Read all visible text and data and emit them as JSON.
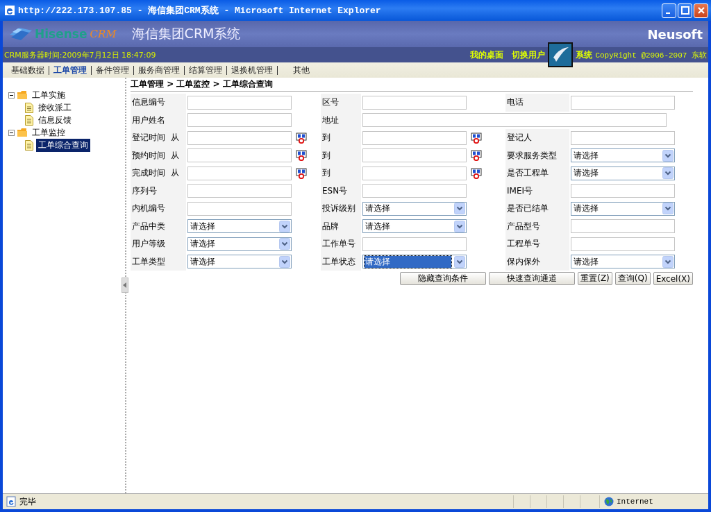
{
  "window": {
    "title": "http://222.173.107.85 - 海信集团CRM系统 - Microsoft Internet Explorer"
  },
  "header": {
    "brand": "Hisense",
    "brand_suffix": "CRM",
    "system_name": "海信集团CRM系统",
    "vendor": "Neusoft"
  },
  "info_bar": {
    "server_time": "CRM服务器时间:2009年7月12日 18:47:09",
    "links": [
      "我的桌面",
      "切换用户",
      "系统"
    ],
    "copyright": "CopyRight @2006-2007 东软"
  },
  "nav": [
    {
      "label": "基础数据",
      "selected": false
    },
    {
      "label": "工单管理",
      "selected": true
    },
    {
      "label": "备件管理",
      "selected": false
    },
    {
      "label": "服务商管理",
      "selected": false
    },
    {
      "label": "结算管理",
      "selected": false
    },
    {
      "label": "退换机管理",
      "selected": false
    },
    {
      "label": "其他",
      "selected": false
    }
  ],
  "tree": [
    {
      "label": "工单实施",
      "expanded": true,
      "children": [
        {
          "label": "接收派工",
          "selected": false
        },
        {
          "label": "信息反馈",
          "selected": false
        }
      ]
    },
    {
      "label": "工单监控",
      "expanded": true,
      "children": [
        {
          "label": "工单综合查询",
          "selected": true
        }
      ]
    }
  ],
  "breadcrumb": "工单管理 > 工单监控 > 工单综合查询",
  "form_rows": [
    {
      "fields": [
        {
          "label": "信息编号",
          "kind": "text"
        },
        {
          "label": "区号",
          "kind": "text"
        },
        {
          "label": "电话",
          "kind": "text"
        }
      ]
    },
    {
      "fields": [
        {
          "label": "用户姓名",
          "kind": "text"
        },
        {
          "label": "地址",
          "kind": "wide"
        }
      ]
    },
    {
      "fields": [
        {
          "label": "登记时间  从",
          "kind": "date"
        },
        {
          "label": "到",
          "kind": "date"
        },
        {
          "label": "登记人",
          "kind": "text"
        }
      ]
    },
    {
      "fields": [
        {
          "label": "预约时间  从",
          "kind": "date"
        },
        {
          "label": "到",
          "kind": "date"
        },
        {
          "label": "要求服务类型",
          "kind": "select",
          "value": "请选择",
          "focused": false
        }
      ]
    },
    {
      "fields": [
        {
          "label": "完成时间  从",
          "kind": "date"
        },
        {
          "label": "到",
          "kind": "date"
        },
        {
          "label": "是否工程单",
          "kind": "select",
          "value": "请选择",
          "focused": false
        }
      ]
    },
    {
      "fields": [
        {
          "label": "序列号",
          "kind": "text"
        },
        {
          "label": "ESN号",
          "kind": "text"
        },
        {
          "label": "IMEI号",
          "kind": "text"
        }
      ]
    },
    {
      "fields": [
        {
          "label": "内机编号",
          "kind": "text"
        },
        {
          "label": "投诉级别",
          "kind": "select",
          "value": "请选择",
          "focused": false
        },
        {
          "label": "是否已结单",
          "kind": "select",
          "value": "请选择",
          "focused": false
        }
      ]
    },
    {
      "fields": [
        {
          "label": "产品中类",
          "kind": "select",
          "value": "请选择",
          "focused": false
        },
        {
          "label": "品牌",
          "kind": "select",
          "value": "请选择",
          "focused": false
        },
        {
          "label": "产品型号",
          "kind": "text"
        }
      ]
    },
    {
      "fields": [
        {
          "label": "用户等级",
          "kind": "select",
          "value": "请选择",
          "focused": false
        },
        {
          "label": "工作单号",
          "kind": "text"
        },
        {
          "label": "工程单号",
          "kind": "text"
        }
      ]
    },
    {
      "fields": [
        {
          "label": "工单类型",
          "kind": "select",
          "value": "请选择",
          "focused": false
        },
        {
          "label": "工单状态",
          "kind": "select",
          "value": "请选择",
          "focused": true
        },
        {
          "label": "保内保外",
          "kind": "select",
          "value": "请选择",
          "focused": false
        }
      ]
    }
  ],
  "buttons": [
    "隐藏查询条件",
    "快速查询通道",
    "重置(Z)",
    "查询(Q)",
    "Excel(X)"
  ],
  "status_bar": {
    "text": "完毕",
    "zone": "Internet"
  }
}
